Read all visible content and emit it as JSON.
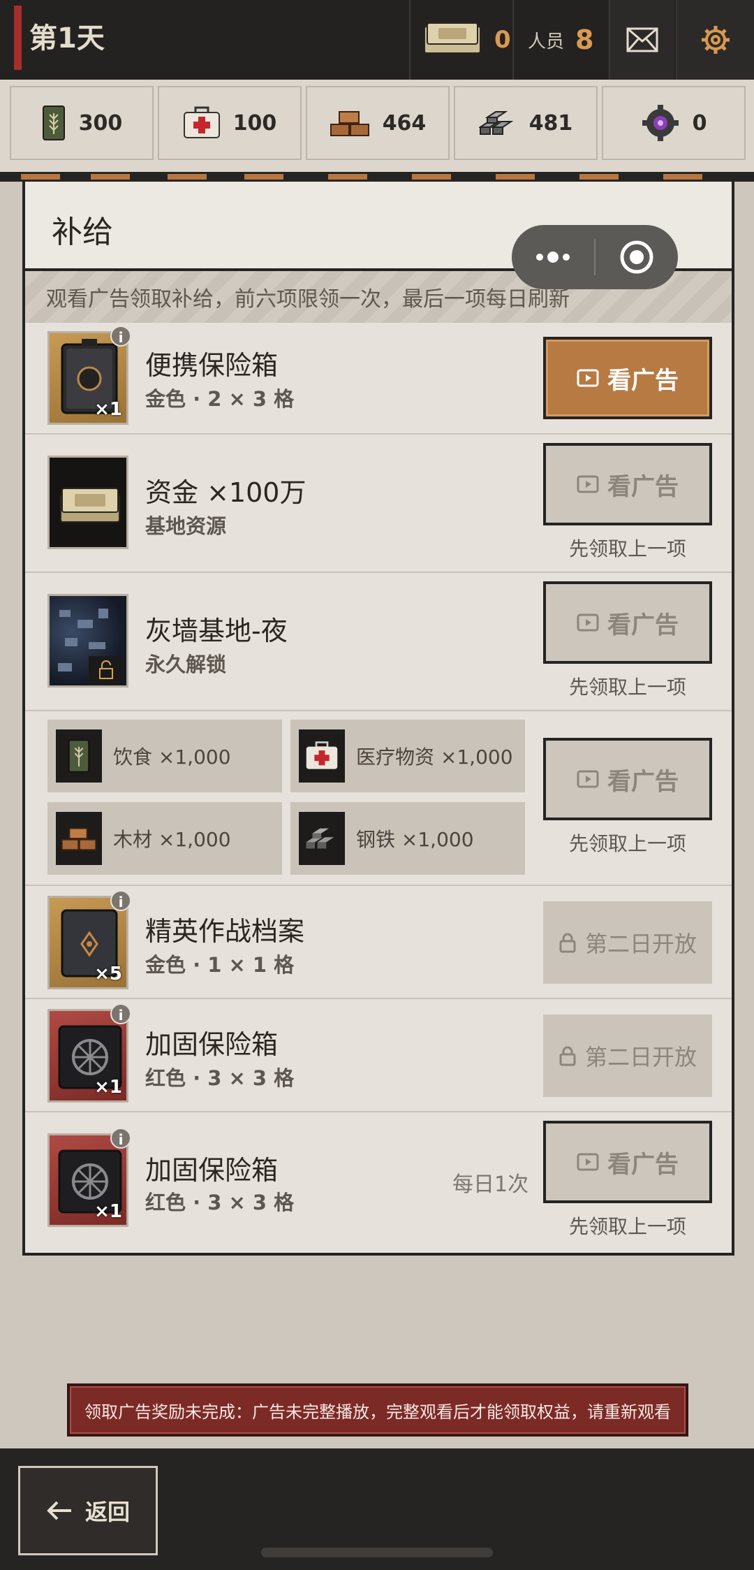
{
  "topbar": {
    "day": "第1天",
    "money": "0",
    "staff_label": "人员",
    "staff_count": "8"
  },
  "resources": [
    {
      "name": "food",
      "icon": "wheat-can-icon",
      "value": "300"
    },
    {
      "name": "medical",
      "icon": "medkit-icon",
      "value": "100"
    },
    {
      "name": "wood",
      "icon": "wood-planks-icon",
      "value": "464"
    },
    {
      "name": "steel",
      "icon": "steel-ingots-icon",
      "value": "481"
    },
    {
      "name": "parts",
      "icon": "gear-gem-icon",
      "value": "0"
    }
  ],
  "panel": {
    "title": "补给",
    "notice": "观看广告领取补给，前六项限领一次，最后一项每日刷新",
    "info_symbol": "i",
    "items": [
      {
        "name": "便携保险箱",
        "sub": "金色 · 2 × 3 格",
        "qty": "×1",
        "button": "看广告"
      },
      {
        "name": "资金 ×100万",
        "sub": "基地资源",
        "button": "看广告",
        "note": "先领取上一项"
      },
      {
        "name": "灰墙基地-夜",
        "sub": "永久解锁",
        "button": "看广告",
        "note": "先领取上一项"
      },
      {
        "button": "看广告",
        "note": "先领取上一项",
        "bundle": [
          {
            "label": "饮食 ×1,000",
            "icon": "wheat-can-icon"
          },
          {
            "label": "医疗物资 ×1,000",
            "icon": "medkit-icon"
          },
          {
            "label": "木材 ×1,000",
            "icon": "wood-planks-icon"
          },
          {
            "label": "钢铁 ×1,000",
            "icon": "steel-ingots-icon"
          }
        ]
      },
      {
        "name": "精英作战档案",
        "sub": "金色 · 1 × 1 格",
        "qty": "×5",
        "button": "第二日开放"
      },
      {
        "name": "加固保险箱",
        "sub": "红色 · 3 × 3 格",
        "qty": "×1",
        "button": "第二日开放"
      },
      {
        "name": "加固保险箱",
        "sub": "红色 · 3 × 3 格",
        "qty": "×1",
        "daily": "每日1次",
        "button": "看广告",
        "note": "先领取上一项"
      }
    ]
  },
  "toast": "领取广告奖励未完成：广告未完整播放，完整观看后才能领取权益，请重新观看",
  "back_label": "返回",
  "colors": {
    "accent": "#b77a43",
    "topbar": "#242220",
    "toast": "#7c2a26"
  }
}
